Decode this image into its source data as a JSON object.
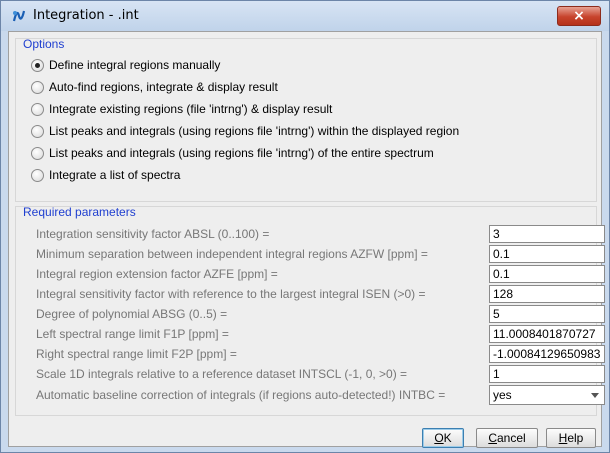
{
  "window": {
    "title": "Integration - .int",
    "close_label": "×"
  },
  "options": {
    "title": "Options",
    "items": [
      {
        "label": "Define integral regions manually",
        "checked": true
      },
      {
        "label": "Auto-find regions, integrate & display result",
        "checked": false
      },
      {
        "label": "Integrate existing regions (file 'intrng') & display result",
        "checked": false
      },
      {
        "label": "List peaks and integrals (using regions file 'intrng') within the displayed region",
        "checked": false
      },
      {
        "label": "List peaks and integrals (using regions file 'intrng') of the entire spectrum",
        "checked": false
      },
      {
        "label": "Integrate a list of spectra",
        "checked": false
      }
    ]
  },
  "params": {
    "title": "Required parameters",
    "items": [
      {
        "label": "Integration sensitivity factor ABSL (0..100) =",
        "value": "3"
      },
      {
        "label": "Minimum separation between independent integral regions AZFW [ppm] =",
        "value": "0.1"
      },
      {
        "label": "Integral region extension factor AZFE [ppm] =",
        "value": "0.1"
      },
      {
        "label": "Integral sensitivity factor with reference to the largest integral ISEN (>0) =",
        "value": "128"
      },
      {
        "label": "Degree of polynomial ABSG (0..5) =",
        "value": "5"
      },
      {
        "label": "Left spectral range limit F1P [ppm] =",
        "value": "11.0008401870727"
      },
      {
        "label": "Right spectral range limit F2P [ppm] =",
        "value": "-1.00084129650983"
      },
      {
        "label": "Scale 1D integrals relative to a reference dataset INTSCL (-1, 0, >0) =",
        "value": "1"
      }
    ],
    "baseline": {
      "label": "Automatic baseline correction of integrals (if regions auto-detected!) INTBC =",
      "value": "yes"
    }
  },
  "buttons": {
    "ok": {
      "first": "O",
      "rest": "K"
    },
    "cancel": {
      "first": "C",
      "rest": "ancel"
    },
    "help": {
      "first": "H",
      "rest": "elp"
    }
  }
}
